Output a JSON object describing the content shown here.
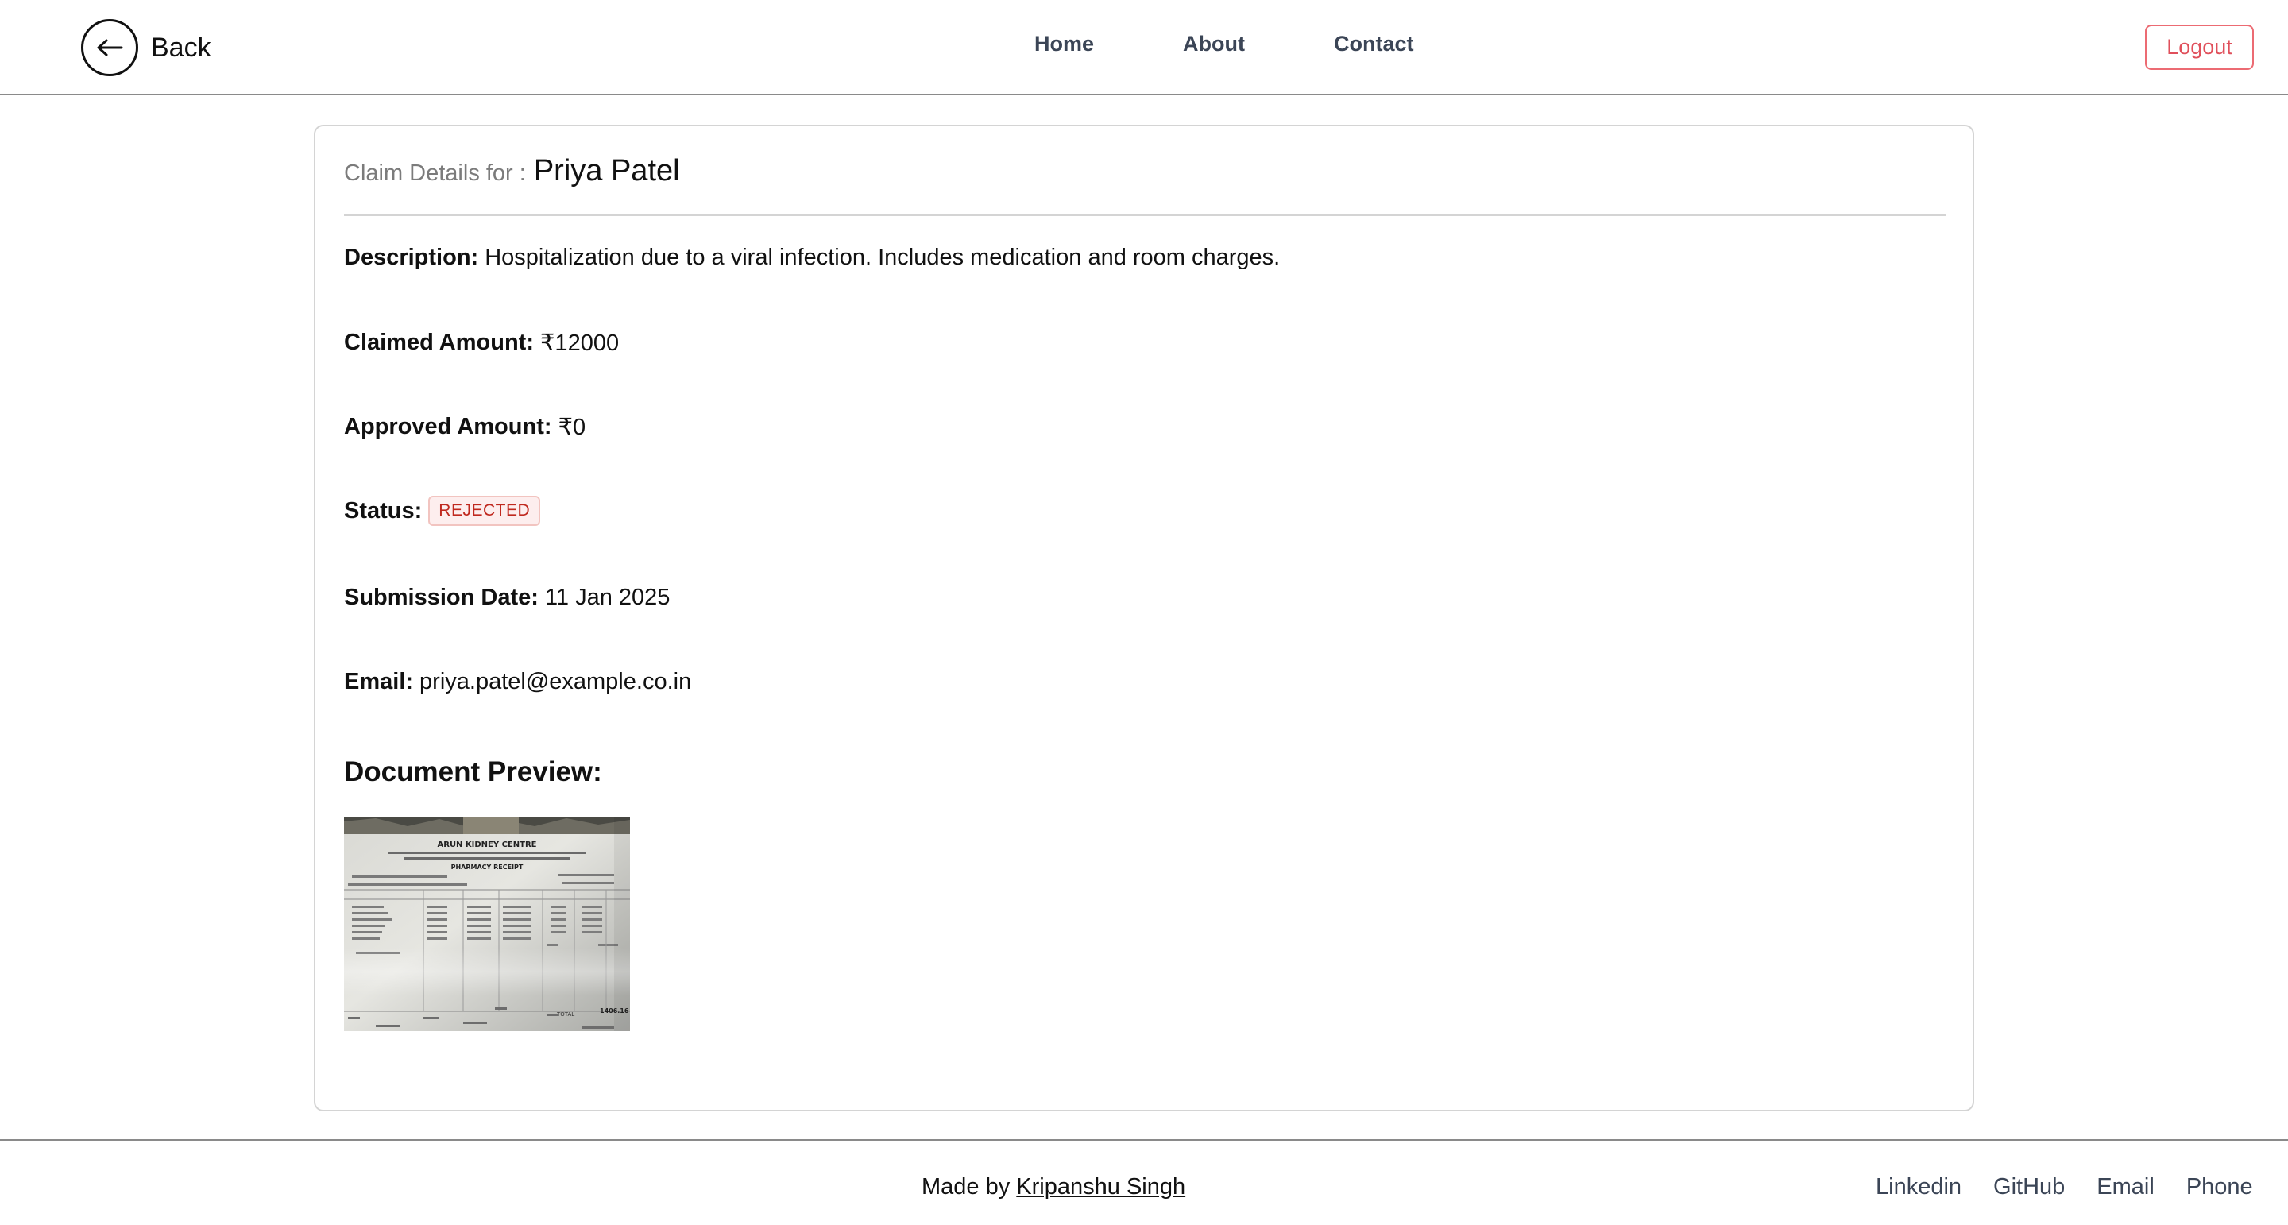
{
  "header": {
    "back_label": "Back",
    "nav": {
      "home": "Home",
      "about": "About",
      "contact": "Contact"
    },
    "logout_label": "Logout"
  },
  "claim": {
    "title_prefix": "Claim Details for :",
    "name": "Priya Patel",
    "description_label": "Description:",
    "description": "Hospitalization due to a viral infection. Includes medication and room charges.",
    "claimed_label": "Claimed Amount:",
    "claimed_amount": "₹12000",
    "approved_label": "Approved Amount:",
    "approved_amount": "₹0",
    "status_label": "Status:",
    "status": "REJECTED",
    "submission_label": "Submission Date:",
    "submission_date": "11 Jan 2025",
    "email_label": "Email:",
    "email": "priya.patel@example.co.in",
    "document_heading": "Document Preview:"
  },
  "document_receipt": {
    "clinic_name": "ARUN KIDNEY CENTRE",
    "receipt_title": "PHARMACY RECEIPT",
    "total_label": "TOTAL",
    "total_value": "1406.16"
  },
  "footer": {
    "made_by_prefix": "Made by",
    "author": "Kripanshu Singh",
    "links": {
      "linkedin": "Linkedin",
      "github": "GitHub",
      "email": "Email",
      "phone": "Phone"
    }
  },
  "colors": {
    "accent_logout": "#e0505b",
    "status_rejected": "#c0291f",
    "nav_text": "#3b4556"
  },
  "icons": {
    "back": "arrow-left-icon"
  }
}
